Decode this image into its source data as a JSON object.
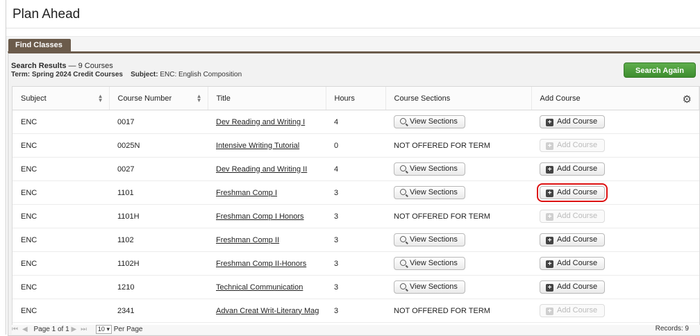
{
  "page": {
    "title": "Plan Ahead"
  },
  "tabs": [
    {
      "label": "Find Classes"
    }
  ],
  "search": {
    "title": "Search Results",
    "count_label": " — 9 Courses",
    "term_label": "Term: Spring 2024 Credit Courses",
    "subject_label": "Subject:",
    "subject_value": " ENC: English Composition",
    "search_again": "Search Again"
  },
  "table": {
    "headers": [
      "Subject",
      "Course Number",
      "Title",
      "Hours",
      "Course Sections",
      "Add Course"
    ],
    "view_sections_label": "View Sections",
    "add_course_label": "Add Course",
    "not_offered_label": "NOT OFFERED FOR TERM",
    "rows": [
      {
        "subject": "ENC",
        "number": "0017",
        "title": "Dev Reading and Writing I",
        "hours": "4",
        "offered": true
      },
      {
        "subject": "ENC",
        "number": "0025N",
        "title": "Intensive Writing Tutorial",
        "hours": "0",
        "offered": false
      },
      {
        "subject": "ENC",
        "number": "0027",
        "title": "Dev Reading and Writing II",
        "hours": "4",
        "offered": true
      },
      {
        "subject": "ENC",
        "number": "1101",
        "title": "Freshman Comp I",
        "hours": "3",
        "offered": true,
        "highlighted": true
      },
      {
        "subject": "ENC",
        "number": "1101H",
        "title": "Freshman Comp I Honors",
        "hours": "3",
        "offered": false
      },
      {
        "subject": "ENC",
        "number": "1102",
        "title": "Freshman Comp II",
        "hours": "3",
        "offered": true
      },
      {
        "subject": "ENC",
        "number": "1102H",
        "title": "Freshman Comp II-Honors",
        "hours": "3",
        "offered": true
      },
      {
        "subject": "ENC",
        "number": "1210",
        "title": "Technical Communication",
        "hours": "3",
        "offered": true
      },
      {
        "subject": "ENC",
        "number": "2341",
        "title": "Advan Creat Writ-Literary Mag",
        "hours": "3",
        "offered": false
      }
    ]
  },
  "pager": {
    "page_label": "Page",
    "page_current": "1",
    "of_label": "of",
    "page_total": "1",
    "per_page_value": "10",
    "per_page_label": "Per Page",
    "records": "Records: 9"
  },
  "colors": {
    "accent": "#6b5b4b",
    "primary_button": "#4a9c3a",
    "highlight": "#dd1111"
  }
}
